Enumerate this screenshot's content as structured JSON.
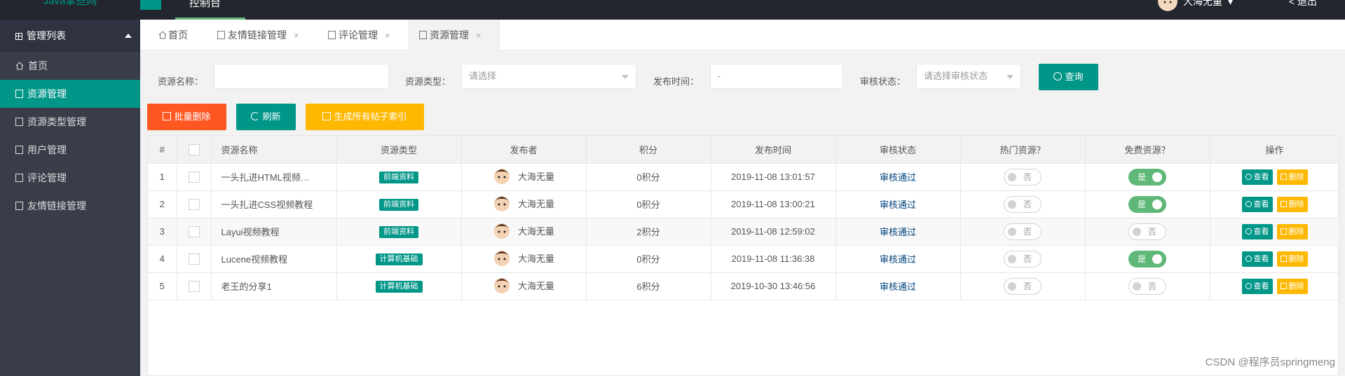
{
  "header": {
    "logo_text": "Java拿些网",
    "top_tab": "控制台",
    "user_name": "大海无量",
    "logout": "退出"
  },
  "sidebar": {
    "title": "管理列表",
    "items": [
      {
        "label": "首页",
        "icon": "home-icon",
        "active": false
      },
      {
        "label": "资源管理",
        "icon": "doc-icon",
        "active": true
      },
      {
        "label": "资源类型管理",
        "icon": "doc-icon",
        "active": false
      },
      {
        "label": "用户管理",
        "icon": "doc-icon",
        "active": false
      },
      {
        "label": "评论管理",
        "icon": "doc-icon",
        "active": false
      },
      {
        "label": "友情链接管理",
        "icon": "doc-icon",
        "active": false
      }
    ]
  },
  "tabs": [
    {
      "label": "首页",
      "closable": false
    },
    {
      "label": "友情链接管理",
      "closable": true,
      "close": "×"
    },
    {
      "label": "评论管理",
      "closable": true,
      "close": "×"
    },
    {
      "label": "资源管理",
      "closable": true,
      "close": "×"
    }
  ],
  "filters": {
    "name_label": "资源名称：",
    "name_value": "",
    "type_label": "资源类型：",
    "type_placeholder": "请选择",
    "time_label": "发布时间：",
    "time_value": "-",
    "status_label": "审核状态：",
    "status_placeholder": "请选择审核状态",
    "query_button": "查询"
  },
  "actions": {
    "batch_delete": "批量删除",
    "refresh": "刷新",
    "generate_index": "生成所有帖子索引"
  },
  "table": {
    "columns": [
      "#",
      "",
      "资源名称",
      "资源类型",
      "发布者",
      "积分",
      "发布时间",
      "审核状态",
      "热门资源？",
      "免费资源？",
      "操作"
    ],
    "view_label": "查看",
    "delete_label": "删除",
    "switch_on": "是",
    "switch_off": "否",
    "rows": [
      {
        "index": "1",
        "name": "一头扎进HTML视频…",
        "type": "前端资料",
        "publisher": "大海无量",
        "points": "0积分",
        "time": "2019-11-08 13:01:57",
        "status": "审核通过",
        "hot": false,
        "free": true
      },
      {
        "index": "2",
        "name": "一头扎进CSS视频教程",
        "type": "前端资料",
        "publisher": "大海无量",
        "points": "0积分",
        "time": "2019-11-08 13:00:21",
        "status": "审核通过",
        "hot": false,
        "free": true
      },
      {
        "index": "3",
        "name": "Layui视频教程",
        "type": "前端资料",
        "publisher": "大海无量",
        "points": "2积分",
        "time": "2019-11-08 12:59:02",
        "status": "审核通过",
        "hot": false,
        "free": false
      },
      {
        "index": "4",
        "name": "Lucene视频教程",
        "type": "计算机基础",
        "publisher": "大海无量",
        "points": "0积分",
        "time": "2019-11-08 11:36:38",
        "status": "审核通过",
        "hot": false,
        "free": true
      },
      {
        "index": "5",
        "name": "老王的分享1",
        "type": "计算机基础",
        "publisher": "大海无量",
        "points": "6积分",
        "time": "2019-10-30 13:46:56",
        "status": "审核通过",
        "hot": false,
        "free": false
      }
    ]
  },
  "watermark": "CSDN @程序员springmeng",
  "colors": {
    "primary": "#009688",
    "danger": "#ff5722",
    "warn": "#ffb800",
    "switch_on": "#5fb878",
    "sidebar": "#393d49",
    "topbar": "#23262e"
  }
}
